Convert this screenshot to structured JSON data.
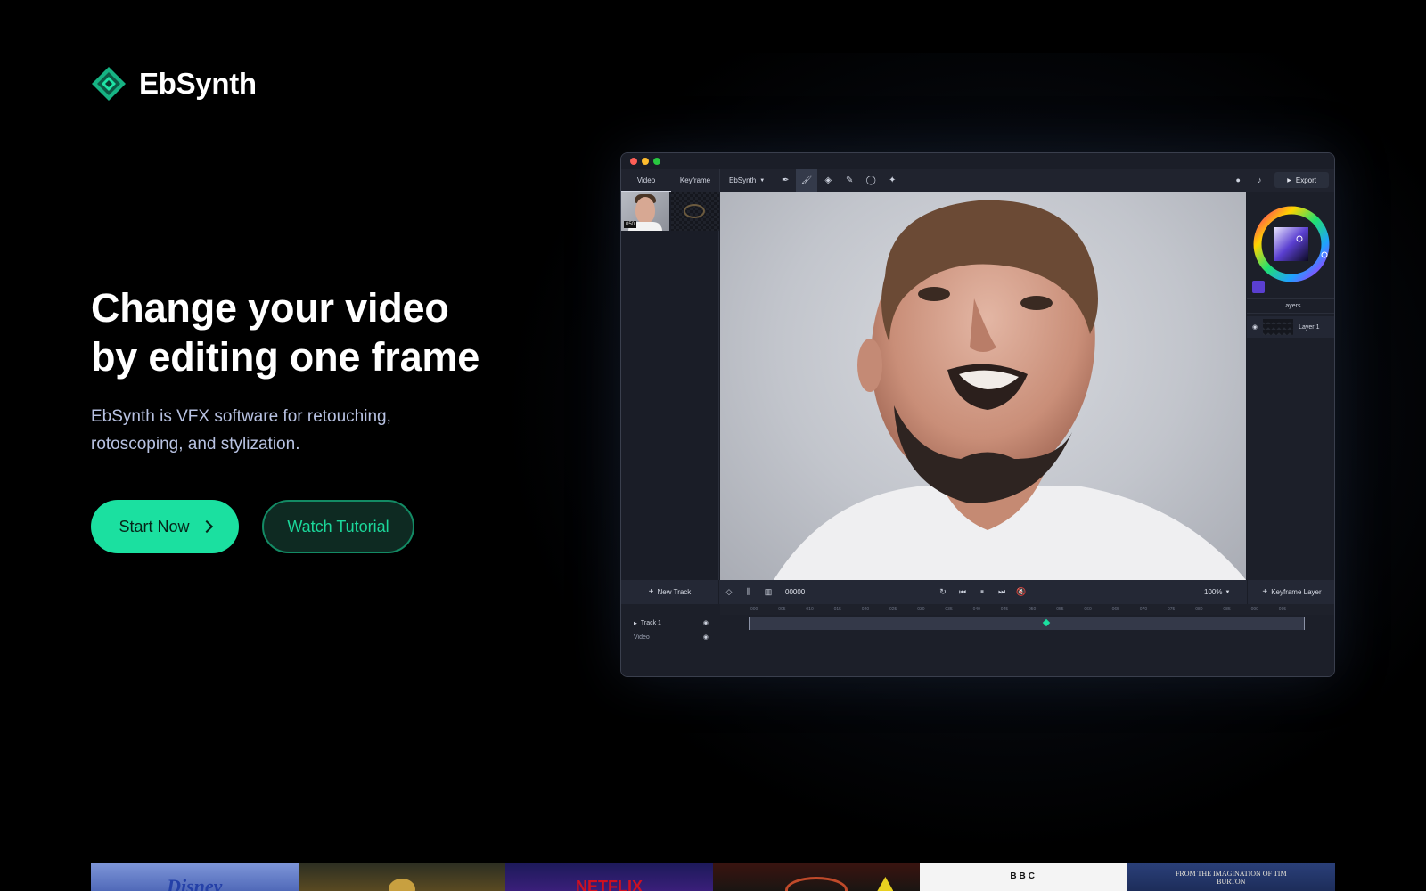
{
  "brand": {
    "name": "EbSynth"
  },
  "hero": {
    "title_line1": "Change your video",
    "title_line2": "by editing one frame",
    "subtitle_line1": "EbSynth is VFX software for retouching,",
    "subtitle_line2": "rotoscoping, and stylization.",
    "primary_cta": "Start Now",
    "secondary_cta": "Watch Tutorial"
  },
  "app": {
    "toolbar": {
      "tab_video": "Video",
      "tab_keyframe": "Keyframe",
      "mode_select": "EbSynth",
      "export_label": "Export"
    },
    "sidebar": {
      "thumb_frame": "050"
    },
    "layers": {
      "title": "Layers",
      "items": [
        {
          "label": "Layer 1"
        }
      ]
    },
    "controls": {
      "new_track": "New Track",
      "frame_counter": "00000",
      "zoom": "100%",
      "keyframe_layer": "Keyframe Layer"
    },
    "ruler": [
      "000",
      "005",
      "010",
      "015",
      "020",
      "025",
      "030",
      "035",
      "040",
      "045",
      "050",
      "055",
      "060",
      "065",
      "070",
      "075",
      "080",
      "085",
      "090",
      "095"
    ],
    "tracks": [
      {
        "label": "Track 1"
      },
      {
        "label": "Video"
      }
    ]
  },
  "logos": [
    {
      "name": "Disney"
    },
    {
      "name": ""
    },
    {
      "name": "NETFLIX"
    },
    {
      "name": ""
    },
    {
      "name": "BBC"
    },
    {
      "name": "FROM THE IMAGINATION OF TIM BURTON"
    }
  ],
  "colors": {
    "accent": "#1be0a0",
    "background": "#000000",
    "subtitle": "#b8c2e2",
    "swatch": "#5a3fd0"
  }
}
